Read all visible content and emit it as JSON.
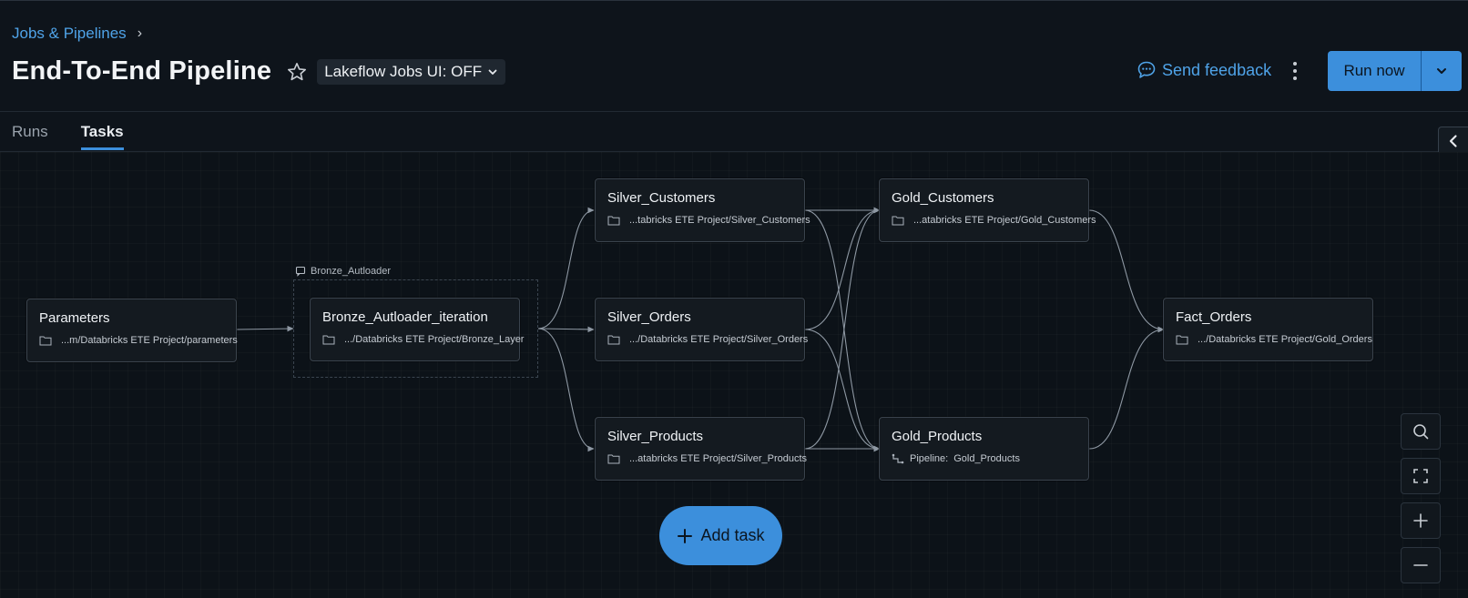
{
  "breadcrumb": {
    "label": "Jobs & Pipelines"
  },
  "header": {
    "title": "End-To-End Pipeline",
    "ui_toggle_label": "Lakeflow Jobs UI: OFF",
    "feedback_label": "Send feedback",
    "run_label": "Run now"
  },
  "tabs": [
    {
      "label": "Runs",
      "active": false
    },
    {
      "label": "Tasks",
      "active": true
    }
  ],
  "loop": {
    "label": "Bronze_Autloader"
  },
  "nodes": [
    {
      "title": "Parameters",
      "path": "...m/Databricks ETE Project/parameters",
      "icon": "folder-icon"
    },
    {
      "title": "Bronze_Autloader_iteration",
      "path": ".../Databricks ETE Project/Bronze_Layer",
      "icon": "folder-icon"
    },
    {
      "title": "Silver_Customers",
      "path": "...tabricks ETE Project/Silver_Customers",
      "icon": "folder-icon"
    },
    {
      "title": "Silver_Orders",
      "path": ".../Databricks ETE Project/Silver_Orders",
      "icon": "folder-icon"
    },
    {
      "title": "Silver_Products",
      "path": "...atabricks ETE Project/Silver_Products",
      "icon": "folder-icon"
    },
    {
      "title": "Gold_Customers",
      "path": "...atabricks ETE Project/Gold_Customers",
      "icon": "folder-icon"
    },
    {
      "title": "Gold_Products",
      "path_prefix": "Pipeline:",
      "path": "Gold_Products",
      "icon": "pipeline-icon"
    },
    {
      "title": "Fact_Orders",
      "path": ".../Databricks ETE Project/Gold_Orders",
      "icon": "folder-icon"
    }
  ],
  "add_task_label": "Add task",
  "colors": {
    "accent": "#3c8fdc",
    "link": "#4fa3e8",
    "background": "#0e141b",
    "node_border": "#3a434d",
    "edge": "#8e98a3"
  }
}
